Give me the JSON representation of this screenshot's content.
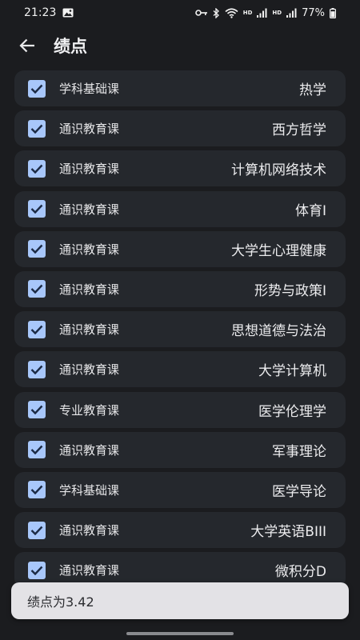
{
  "status_bar": {
    "time": "21:23",
    "battery": "77%",
    "hd1": "HD",
    "hd2": "HD",
    "icons": [
      "image-icon",
      "key-icon",
      "bluetooth-icon",
      "wifi-icon",
      "signal-icon",
      "battery-icon"
    ]
  },
  "app_bar": {
    "title": "绩点",
    "back_icon": "arrow-left-icon"
  },
  "colors": {
    "background": "#1b1c1f",
    "card": "#25282d",
    "checkbox": "#a8c7fa",
    "snackbar": "#e3e2e6"
  },
  "courses": [
    {
      "type": "学科基础课",
      "name": "热学",
      "checked": true
    },
    {
      "type": "通识教育课",
      "name": "西方哲学",
      "checked": true
    },
    {
      "type": "通识教育课",
      "name": "计算机网络技术",
      "checked": true
    },
    {
      "type": "通识教育课",
      "name": "体育I",
      "checked": true
    },
    {
      "type": "通识教育课",
      "name": "大学生心理健康",
      "checked": true
    },
    {
      "type": "通识教育课",
      "name": "形势与政策I",
      "checked": true
    },
    {
      "type": "通识教育课",
      "name": "思想道德与法治",
      "checked": true
    },
    {
      "type": "通识教育课",
      "name": "大学计算机",
      "checked": true
    },
    {
      "type": "专业教育课",
      "name": "医学伦理学",
      "checked": true
    },
    {
      "type": "通识教育课",
      "name": "军事理论",
      "checked": true
    },
    {
      "type": "学科基础课",
      "name": "医学导论",
      "checked": true
    },
    {
      "type": "通识教育课",
      "name": "大学英语BIII",
      "checked": true
    },
    {
      "type": "通识教育课",
      "name": "微积分D",
      "checked": true
    }
  ],
  "snackbar": {
    "message": "绩点为3.42"
  }
}
